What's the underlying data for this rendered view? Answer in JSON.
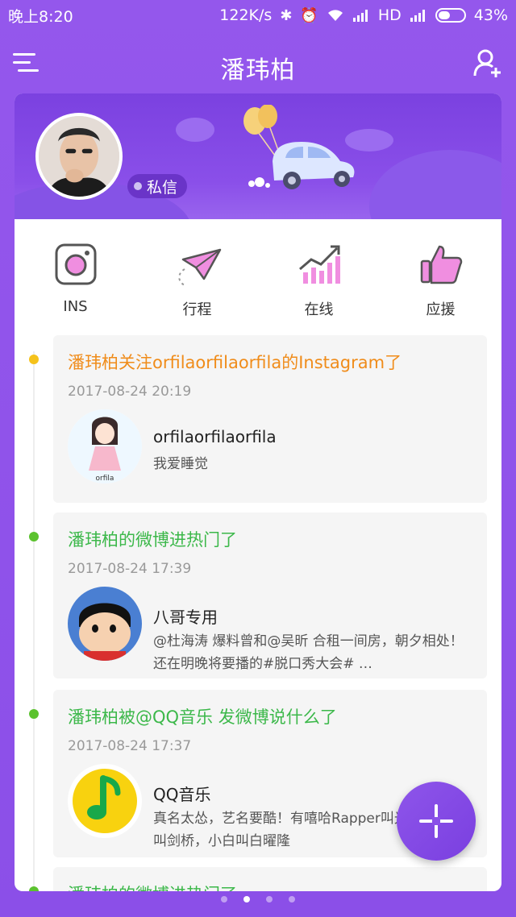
{
  "status_bar": {
    "time": "晚上8:20",
    "network_speed": "122K/s",
    "network_type": "HD",
    "battery": "43%"
  },
  "app_bar": {
    "title": "潘玮柏"
  },
  "profile": {
    "dm_label": "私信"
  },
  "quick_actions": [
    {
      "label": "INS",
      "icon": "instagram-icon"
    },
    {
      "label": "行程",
      "icon": "paper-plane-icon"
    },
    {
      "label": "在线",
      "icon": "trend-chart-icon"
    },
    {
      "label": "应援",
      "icon": "thumbs-up-icon"
    }
  ],
  "feed": [
    {
      "title": "潘玮柏关注orfilaorfilaorfila的Instagram了",
      "time": "2017-08-24 20:19",
      "user": "orfilaorfilaorfila",
      "text": "我爱睡觉",
      "color": "#f08c1a",
      "dot": "#f5c21b",
      "thumb_label": "orfila"
    },
    {
      "title": "潘玮柏的微博进热门了",
      "time": "2017-08-24 17:39",
      "user": "八哥专用",
      "text": "@杜海涛 爆料曾和@吴昕 合租一间房，朝夕相处！还在明晚将要播的#脱口秀大会# …",
      "color": "#3cb84a",
      "dot": "#5bc22e"
    },
    {
      "title": "潘玮柏被@QQ音乐 发微博说什么了",
      "time": "2017-08-24 17:37",
      "user": "QQ音乐",
      "text": "真名太怂，艺名要酷！有嘻哈Rapper叫光，Bridge叫剑桥，小白叫白曜隆",
      "color": "#3cb84a",
      "dot": "#5bc22e"
    },
    {
      "title": "潘玮柏的微博进热门了",
      "color": "#3cb84a",
      "dot": "#5bc22e"
    }
  ],
  "colors": {
    "accent": "#8f52ea",
    "instagram_pink": "#f08ee0",
    "orange": "#f08c1a",
    "green": "#3cb84a"
  }
}
